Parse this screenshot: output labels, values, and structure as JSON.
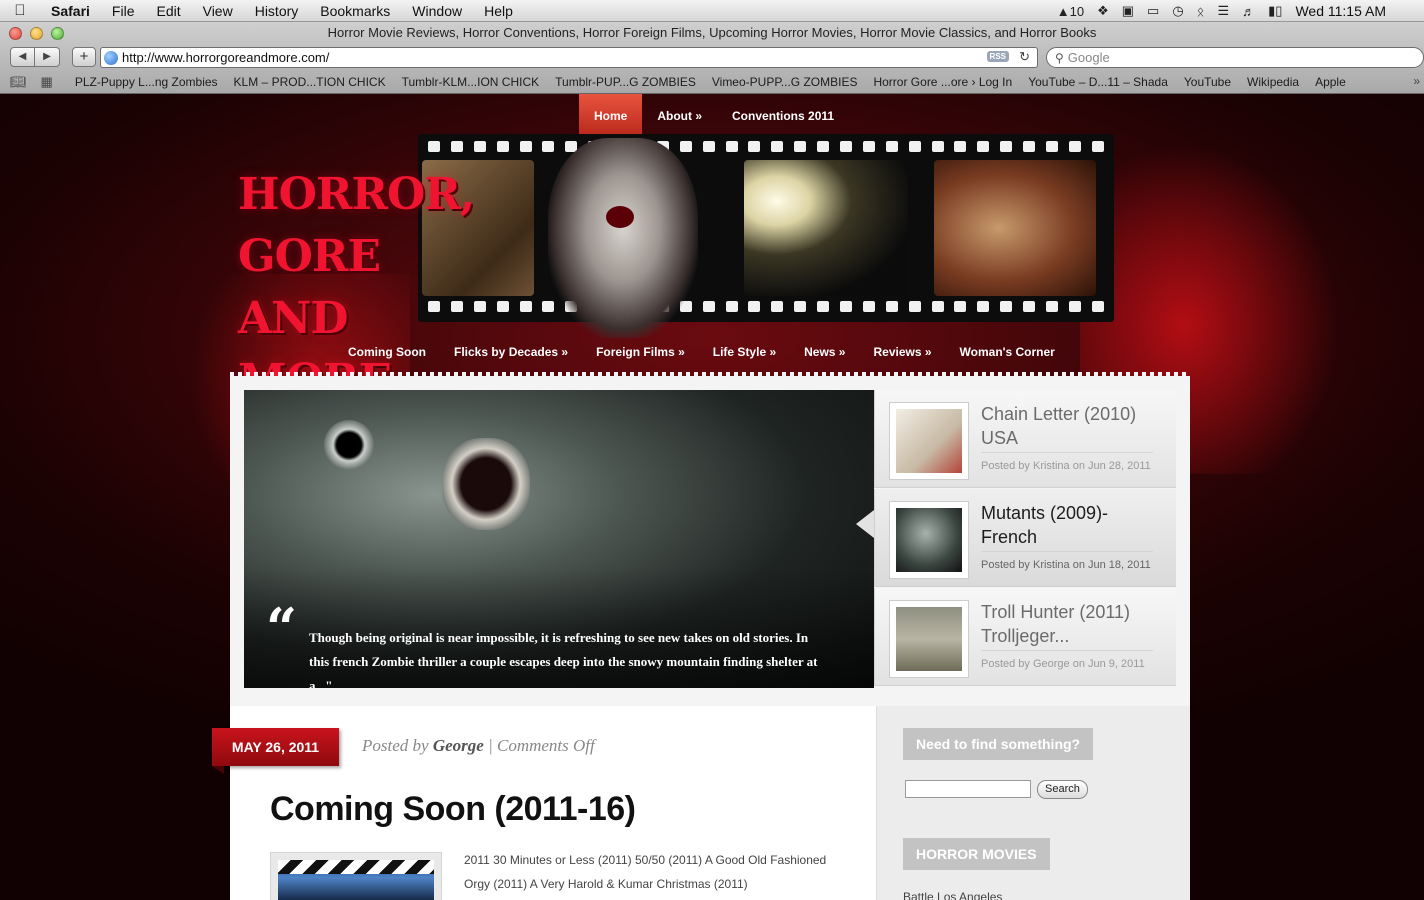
{
  "menubar": {
    "app": "Safari",
    "items": [
      "File",
      "Edit",
      "View",
      "History",
      "Bookmarks",
      "Window",
      "Help"
    ],
    "status_icons": [
      "adobe-icon",
      "dropbox-icon",
      "evernote-icon",
      "display-icon",
      "time-machine-icon",
      "bluetooth-icon",
      "wifi-icon",
      "volume-icon",
      "battery-icon"
    ],
    "badge_count": "10",
    "clock": "Wed 11:15 AM"
  },
  "window": {
    "title": "Horror Movie Reviews, Horror Conventions, Horror Foreign Films, Upcoming Horror Movies, Horror Movie Classics, and Horror Books",
    "url": "http://www.horrorgoreandmore.com/",
    "rss": "RSS",
    "search_placeholder": "Google",
    "bookmarks": [
      "PLZ-Puppy L...ng Zombies",
      "KLM – PROD...TION CHICK",
      "Tumblr-KLM...ION CHICK",
      "Tumblr-PUP...G ZOMBIES",
      "Vimeo-PUPP...G ZOMBIES",
      "Horror Gore ...ore › Log In",
      "YouTube – D...11 – Shada",
      "YouTube",
      "Wikipedia",
      "Apple"
    ]
  },
  "site": {
    "top_nav": [
      "Home",
      "About »",
      "Conventions 2011"
    ],
    "logo_line1": "HORROR, GORE",
    "logo_line2": "AND MORE..",
    "category_nav": [
      "Coming Soon",
      "Flicks by Decades »",
      "Foreign Films »",
      "Life Style »",
      "News »",
      "Reviews »",
      "Woman's Corner"
    ],
    "feature": {
      "quote_mark": "“",
      "excerpt": "Though being original is near impossible, it is refreshing to see new takes on old stories. In this french Zombie thriller a couple escapes deep into the snowy mountain finding shelter at a...\""
    },
    "slides": [
      {
        "title": "Chain Letter (2010) USA",
        "meta": "Posted by Kristina on Jun 28, 2011"
      },
      {
        "title": "Mutants (2009)- French",
        "meta": "Posted by Kristina on Jun 18, 2011"
      },
      {
        "title": "Troll Hunter (2011) Trolljeger...",
        "meta": "Posted by George on Jun 9, 2011"
      }
    ],
    "post": {
      "date": "MAY 26, 2011",
      "posted_by": "Posted by",
      "author": "George",
      "comments": "| Comments Off",
      "title": "Coming Soon (2011-16)",
      "excerpt": "2011 30 Minutes or Less (2011) 50/50 (2011) A Good Old Fashioned Orgy (2011) A Very Harold & Kumar Christmas (2011)"
    },
    "sidebar": {
      "search_title": "Need to find something?",
      "search_button": "Search",
      "movies_title": "HORROR MOVIES",
      "first_link": "Battle Los Angeles"
    }
  },
  "colors": {
    "accent_red": "#c9141c",
    "nav_active": "#e8543e",
    "logo_red": "#f01430"
  }
}
